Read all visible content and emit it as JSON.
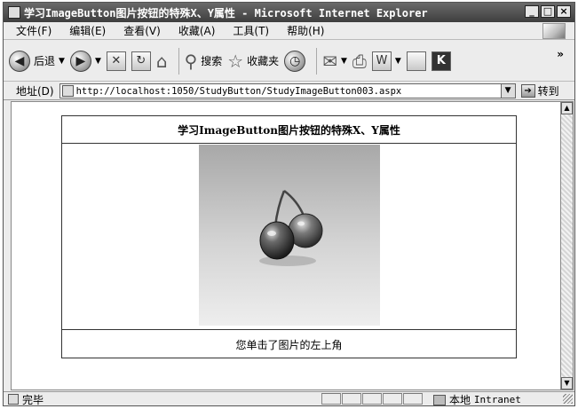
{
  "window": {
    "title": "学习ImageButton图片按钮的特殊X、Y属性 - Microsoft Internet Explorer",
    "controls": [
      "_",
      "□",
      "×"
    ]
  },
  "menubar": {
    "items": [
      {
        "label": "文件(F)"
      },
      {
        "label": "编辑(E)"
      },
      {
        "label": "查看(V)"
      },
      {
        "label": "收藏(A)"
      },
      {
        "label": "工具(T)"
      },
      {
        "label": "帮助(H)"
      }
    ]
  },
  "toolbar": {
    "back_label": "后退",
    "search_label": "搜索",
    "favorites_label": "收藏夹",
    "more": "»"
  },
  "addressbar": {
    "label": "地址(D)",
    "url": "http://localhost:1050/StudyButton/StudyImageButton003.aspx",
    "go_label": "转到"
  },
  "page": {
    "heading": "学习ImageButton图片按钮的特殊X、Y属性",
    "image_alt": "cherries",
    "message": "您单击了图片的左上角"
  },
  "statusbar": {
    "status": "完毕",
    "zone": "本地",
    "zone_type": "Intranet"
  }
}
